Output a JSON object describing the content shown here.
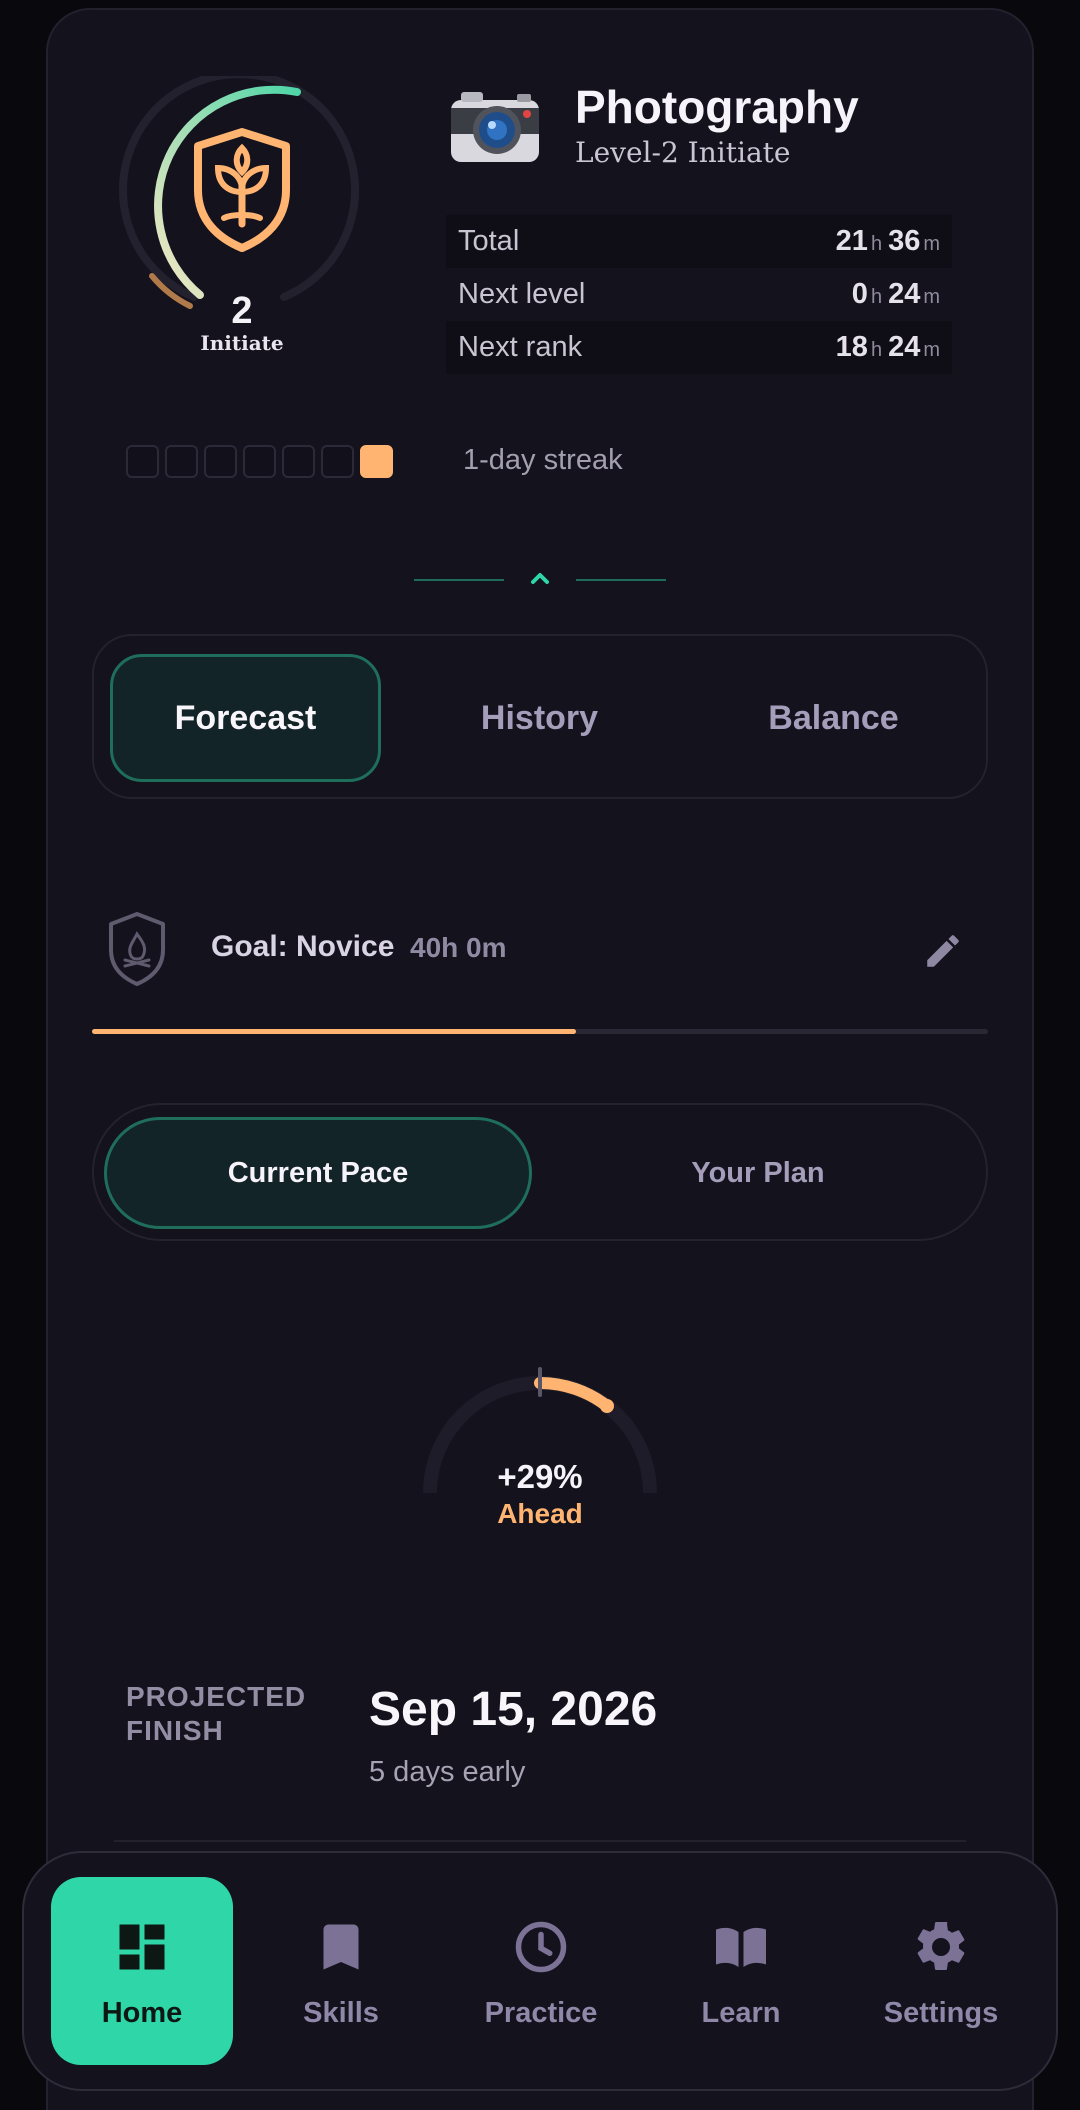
{
  "header": {
    "level_number": "2",
    "level_rank": "Initiate",
    "skill_name": "Photography",
    "skill_subtitle": "Level-2 Initiate",
    "ring_progress": 0.55
  },
  "stats": [
    {
      "label": "Total",
      "h": "21",
      "m": "36"
    },
    {
      "label": "Next level",
      "h": "0",
      "m": "24"
    },
    {
      "label": "Next rank",
      "h": "18",
      "m": "24"
    }
  ],
  "units": {
    "hours": "h",
    "minutes": "m"
  },
  "streak": {
    "days": [
      false,
      false,
      false,
      false,
      false,
      false,
      true
    ],
    "label": "1-day streak"
  },
  "tabs": {
    "forecast": "Forecast",
    "history": "History",
    "balance": "Balance"
  },
  "goal": {
    "title": "Goal: Novice",
    "hours": "40h 0m",
    "progress": 0.54
  },
  "pace": {
    "current": "Current Pace",
    "plan": "Your Plan"
  },
  "gauge": {
    "percent": "+29%",
    "status": "Ahead"
  },
  "projected": {
    "label": "PROJECTED FINISH",
    "date": "Sep 15, 2026",
    "detail": "5 days early"
  },
  "nav": {
    "home": "Home",
    "skills": "Skills",
    "practice": "Practice",
    "learn": "Learn",
    "settings": "Settings"
  },
  "colors": {
    "accent": "#2ed6a8",
    "orange": "#ffb571",
    "background": "#14121d"
  }
}
